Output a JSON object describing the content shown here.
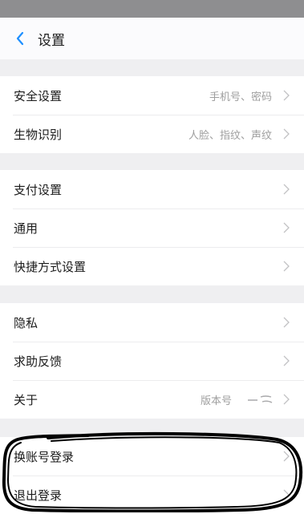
{
  "header": {
    "title": "设置"
  },
  "groups": [
    {
      "items": [
        {
          "label": "安全设置",
          "value": "手机号、密码"
        },
        {
          "label": "生物识别",
          "value": "人脸、指纹、声纹"
        }
      ]
    },
    {
      "items": [
        {
          "label": "支付设置"
        },
        {
          "label": "通用"
        },
        {
          "label": "快捷方式设置"
        }
      ]
    },
    {
      "items": [
        {
          "label": "隐私"
        },
        {
          "label": "求助反馈"
        },
        {
          "label": "关于",
          "value": "版本号"
        }
      ]
    },
    {
      "items": [
        {
          "label": "换账号登录"
        },
        {
          "label": "退出登录"
        }
      ]
    }
  ],
  "colors": {
    "background": "#efeff1",
    "accent": "#1e8fff",
    "annotation": "#000000"
  },
  "icons": {
    "back": "chevron-left-icon",
    "row_arrow": "chevron-right-icon"
  }
}
